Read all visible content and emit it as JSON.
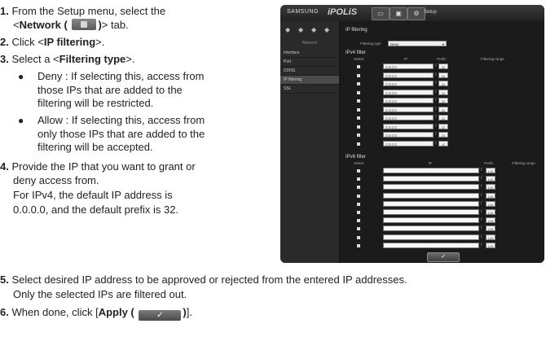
{
  "steps": [
    {
      "num": "1.",
      "line1": "From the Setup menu, select the",
      "line2_pre": "<",
      "line2_bold": "Network (",
      "line2_bold2": ")",
      "line2_post": "> tab."
    },
    {
      "num": "2.",
      "pre": "Click <",
      "bold": "IP filtering",
      "post": ">."
    },
    {
      "num": "3.",
      "pre": "Select a <",
      "bold": "Filtering type",
      "post": ">."
    },
    {
      "num": "4.",
      "lines": [
        "Provide the IP that you want to grant or",
        "deny access from.",
        "For IPv4, the default IP address is",
        "0.0.0.0, and the default prefix is 32."
      ]
    },
    {
      "num": "5.",
      "lines": [
        "Select desired IP address to be approved or rejected from the entered IP addresses.",
        "Only the selected IPs are filtered out."
      ]
    },
    {
      "num": "6.",
      "pre": "When done, click [",
      "bold": "Apply (",
      "bold2": ")",
      "post": "]."
    }
  ],
  "bullets": [
    {
      "lines": [
        "Deny : If selecting this, access from",
        "those IPs that are added to the",
        "filtering will be restricted."
      ]
    },
    {
      "lines": [
        "Allow : If selecting this, access from",
        "only those IPs that are added to the",
        "filtering will be accepted."
      ]
    }
  ],
  "apply_glyph": "✓",
  "screenshot": {
    "brand": "SAMSUNG",
    "brand_product": "iPOLiS",
    "setup_label": "Setup",
    "sidebar_section": "Network",
    "sidebar_items": [
      "Interface",
      "Port",
      "DDNS",
      "IP filtering",
      "SSL"
    ],
    "active_item": "IP filtering",
    "panel_title": "IP filtering",
    "filtering_type_label": "Filtering type",
    "filtering_type_value": "Deny",
    "ipv4_title": "IPv4 filter",
    "ipv6_title": "IPv6 filter",
    "col_select": "Select",
    "col_ip": "IP",
    "col_prefix": "Prefix",
    "col_range": "Filtering range",
    "ipv4_default_ip": "0.0.0.0",
    "ipv4_default_prefix": "32",
    "ipv6_default_prefix": "128",
    "apply_label": "✓"
  }
}
